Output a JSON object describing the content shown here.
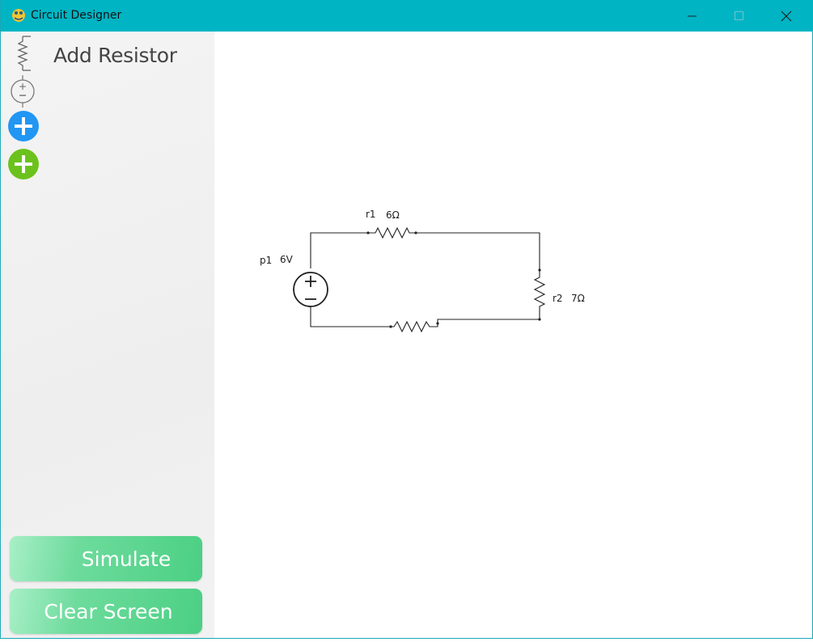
{
  "window": {
    "title": "Circuit Designer",
    "title_bg_color": "#00b4c4",
    "controls": [
      "minimize-icon",
      "maximize-icon",
      "close-icon"
    ]
  },
  "sidebar": {
    "add_resistor_label": "Add Resistor",
    "tools": [
      {
        "icon": "resistor-icon"
      },
      {
        "icon": "voltage-source-icon"
      },
      {
        "icon": "add-blue-icon",
        "color": "#2196f3"
      },
      {
        "icon": "add-green-icon",
        "color": "#6cc21c"
      }
    ],
    "simulate_label": "Simulate",
    "clear_label": "Clear Screen",
    "button_color": "#4bd084"
  },
  "circuit": {
    "source": {
      "name": "p1",
      "value": "6V"
    },
    "resistors": [
      {
        "name": "r1",
        "value": "6Ω"
      },
      {
        "name": "r2",
        "value": "7Ω"
      },
      {
        "name": "",
        "value": ""
      }
    ]
  }
}
